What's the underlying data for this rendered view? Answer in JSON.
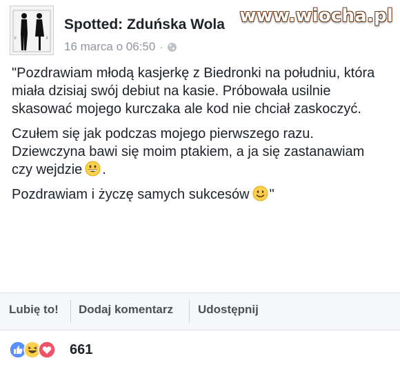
{
  "post": {
    "page_name": "Spotted: Zduńska Wola",
    "timestamp": "16 marca o 06:50",
    "separator": "·",
    "privacy_icon": "globe-icon",
    "avatar_icon": "couple-silhouette-icon",
    "paragraphs": {
      "p1": "\"Pozdrawiam młodą kasjerkę z Biedronki na południu, która miała dzisiaj swój debiut na kasie. Próbowała usilnie skasować mojego kurczaka ale kod nie chciał zaskoczyć.",
      "p2": "Czułem się jak podczas mojego pierwszego razu. Dziewczyna bawi się moim ptakiem, a ja się zastanawiam czy wejdzie",
      "p2_end": ".",
      "p3": "Pozdrawiam i życzę samych sukcesów",
      "p3_end": "\""
    }
  },
  "watermark": "www.wiocha.pl",
  "actions": {
    "like": "Lubię to!",
    "comment": "Dodaj komentarz",
    "share": "Udostępnij"
  },
  "reactions": {
    "icons": [
      "like-icon",
      "haha-icon",
      "love-icon"
    ],
    "count": "661"
  },
  "colors": {
    "like_blue": "#5890ff",
    "haha_yellow": "#fcd04f",
    "love_red": "#f25268",
    "watermark_outline": "#6f3c1a"
  }
}
